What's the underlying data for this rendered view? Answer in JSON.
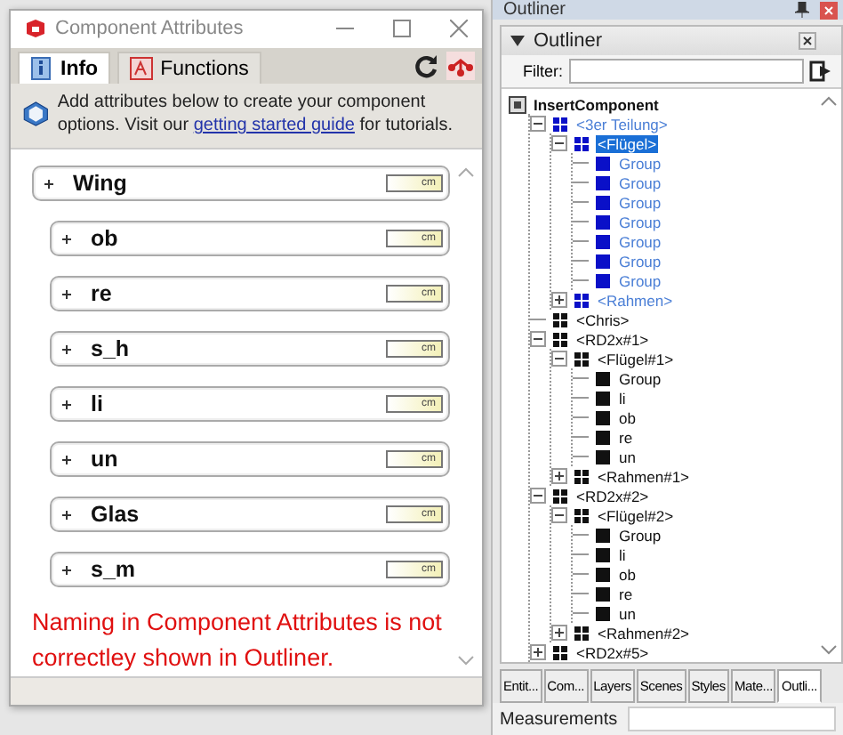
{
  "window": {
    "title": "Component Attributes"
  },
  "tabs": [
    {
      "label": "Info",
      "selected": true,
      "kind": "info"
    },
    {
      "label": "Functions",
      "selected": false,
      "kind": "functions"
    }
  ],
  "info": {
    "text": "Add attributes below to create your component options. Visit our ",
    "link": "getting started guide",
    "after": " for tutorials."
  },
  "attributes": [
    {
      "name": "Wing",
      "unit": "cm",
      "expanded": false,
      "children": [
        {
          "name": "ob",
          "unit": "cm",
          "expanded": false
        },
        {
          "name": "re",
          "unit": "cm",
          "expanded": false
        },
        {
          "name": "s_h",
          "unit": "cm",
          "expanded": false
        },
        {
          "name": "li",
          "unit": "cm",
          "expanded": false
        },
        {
          "name": "un",
          "unit": "cm",
          "expanded": false
        },
        {
          "name": "Glas",
          "unit": "cm",
          "expanded": false
        },
        {
          "name": "s_m",
          "unit": "cm",
          "expanded": false
        }
      ]
    }
  ],
  "note": "Naming in Component Attributes is not correctley shown in Outliner.",
  "outliner": {
    "title": "Outliner",
    "panel_title": "Outliner",
    "filter_label": "Filter:",
    "tree": [
      {
        "label": "InsertComponent",
        "kind": "model",
        "selected": false,
        "children": [
          {
            "label": "<3er Teilung>",
            "kind": "component",
            "expanded": true,
            "selected": false,
            "in_context": true,
            "children": [
              {
                "label": "<Flügel>",
                "kind": "component",
                "expanded": true,
                "selected": true,
                "in_context": true,
                "children": [
                  {
                    "label": "Group",
                    "kind": "group",
                    "selected": false,
                    "in_context": true
                  },
                  {
                    "label": "Group",
                    "kind": "group",
                    "selected": false,
                    "in_context": true
                  },
                  {
                    "label": "Group",
                    "kind": "group",
                    "selected": false,
                    "in_context": true
                  },
                  {
                    "label": "Group",
                    "kind": "group",
                    "selected": false,
                    "in_context": true
                  },
                  {
                    "label": "Group",
                    "kind": "group",
                    "selected": false,
                    "in_context": true
                  },
                  {
                    "label": "Group",
                    "kind": "group",
                    "selected": false,
                    "in_context": true
                  },
                  {
                    "label": "Group",
                    "kind": "group",
                    "selected": false,
                    "in_context": true
                  }
                ]
              },
              {
                "label": "<Rahmen>",
                "kind": "component",
                "expanded": false,
                "selected": false,
                "in_context": true
              }
            ]
          },
          {
            "label": "<Chris>",
            "kind": "component",
            "selected": false,
            "in_context": false
          },
          {
            "label": "<RD2x#1>",
            "kind": "component",
            "expanded": true,
            "selected": false,
            "in_context": false,
            "children": [
              {
                "label": "<Flügel#1>",
                "kind": "component",
                "expanded": true,
                "selected": false,
                "in_context": false,
                "children": [
                  {
                    "label": "Group",
                    "kind": "group",
                    "selected": false,
                    "in_context": false
                  },
                  {
                    "label": "li",
                    "kind": "group",
                    "selected": false,
                    "in_context": false
                  },
                  {
                    "label": "ob",
                    "kind": "group",
                    "selected": false,
                    "in_context": false
                  },
                  {
                    "label": "re",
                    "kind": "group",
                    "selected": false,
                    "in_context": false
                  },
                  {
                    "label": "un",
                    "kind": "group",
                    "selected": false,
                    "in_context": false
                  }
                ]
              },
              {
                "label": "<Rahmen#1>",
                "kind": "component",
                "expanded": false,
                "selected": false,
                "in_context": false
              }
            ]
          },
          {
            "label": "<RD2x#2>",
            "kind": "component",
            "expanded": true,
            "selected": false,
            "in_context": false,
            "children": [
              {
                "label": "<Flügel#2>",
                "kind": "component",
                "expanded": true,
                "selected": false,
                "in_context": false,
                "children": [
                  {
                    "label": "Group",
                    "kind": "group",
                    "selected": false,
                    "in_context": false
                  },
                  {
                    "label": "li",
                    "kind": "group",
                    "selected": false,
                    "in_context": false
                  },
                  {
                    "label": "ob",
                    "kind": "group",
                    "selected": false,
                    "in_context": false
                  },
                  {
                    "label": "re",
                    "kind": "group",
                    "selected": false,
                    "in_context": false
                  },
                  {
                    "label": "un",
                    "kind": "group",
                    "selected": false,
                    "in_context": false
                  }
                ]
              },
              {
                "label": "<Rahmen#2>",
                "kind": "component",
                "expanded": false,
                "selected": false,
                "in_context": false
              }
            ]
          },
          {
            "label": "<RD2x#5>",
            "kind": "component",
            "expanded": false,
            "selected": false,
            "in_context": false
          }
        ]
      }
    ]
  },
  "tray_tabs": [
    {
      "label": "Entit...",
      "selected": false
    },
    {
      "label": "Com...",
      "selected": false
    },
    {
      "label": "Layers",
      "selected": false
    },
    {
      "label": "Scenes",
      "selected": false
    },
    {
      "label": "Styles",
      "selected": false
    },
    {
      "label": "Mate...",
      "selected": false
    },
    {
      "label": "Outli...",
      "selected": true
    }
  ],
  "measurements": {
    "label": "Measurements"
  }
}
